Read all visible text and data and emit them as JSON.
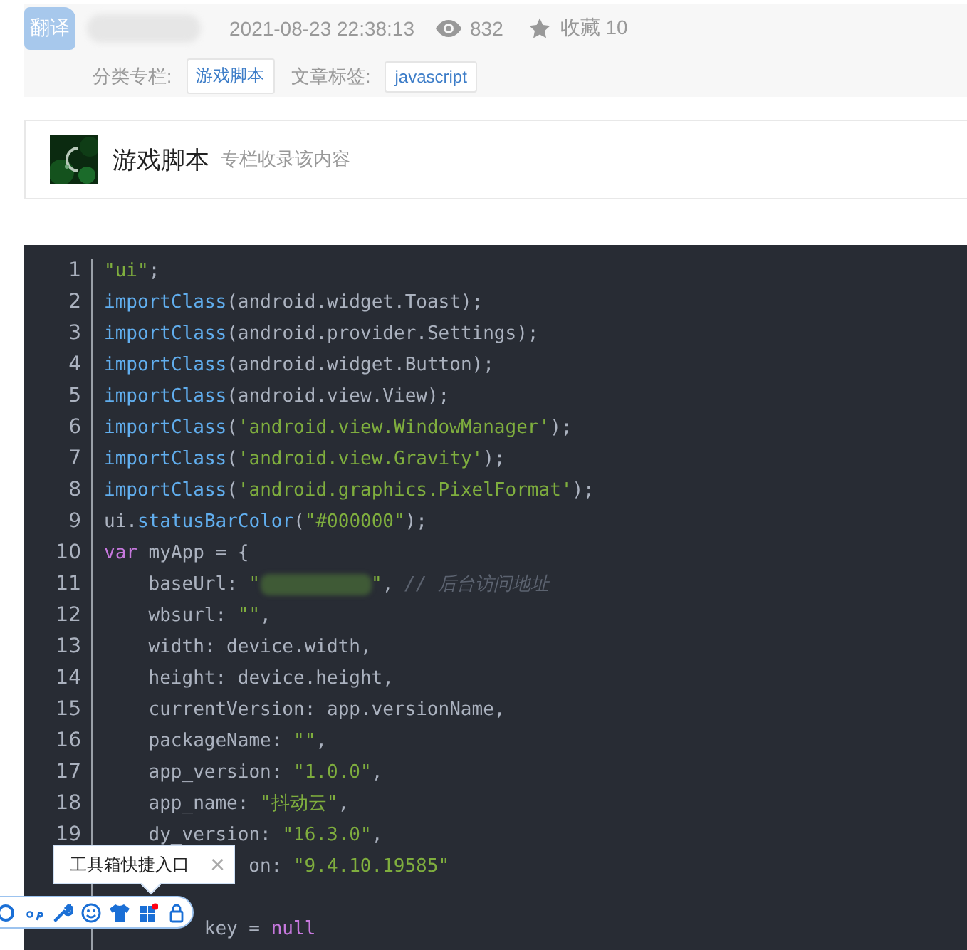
{
  "header": {
    "badge": "翻译",
    "date": "2021-08-23 22:38:13",
    "views": "832",
    "favorites": "收藏 10",
    "category_label": "分类专栏:",
    "category": "游戏脚本",
    "tags_label": "文章标签:",
    "tag": "javascript"
  },
  "column": {
    "title": "游戏脚本",
    "subtitle": "专栏收录该内容"
  },
  "code": [
    {
      "kind": "top",
      "number": "1",
      "segments": [
        {
          "kind": "str",
          "text": "\"ui\""
        },
        {
          "kind": "plain",
          "text": ";"
        }
      ]
    },
    {
      "kind": "top",
      "number": "2",
      "segments": [
        {
          "kind": "fn",
          "text": "importClass"
        },
        {
          "kind": "plain",
          "text": "(android.widget.Toast);"
        }
      ]
    },
    {
      "kind": "top",
      "number": "3",
      "segments": [
        {
          "kind": "fn",
          "text": "importClass"
        },
        {
          "kind": "plain",
          "text": "(android.provider.Settings);"
        }
      ]
    },
    {
      "kind": "top",
      "number": "4",
      "segments": [
        {
          "kind": "fn",
          "text": "importClass"
        },
        {
          "kind": "plain",
          "text": "(android.widget.Button);"
        }
      ]
    },
    {
      "kind": "top",
      "number": "5",
      "segments": [
        {
          "kind": "fn",
          "text": "importClass"
        },
        {
          "kind": "plain",
          "text": "(android.view.View);"
        }
      ]
    },
    {
      "kind": "top",
      "number": "6",
      "segments": [
        {
          "kind": "fn",
          "text": "importClass"
        },
        {
          "kind": "plain",
          "text": "("
        },
        {
          "kind": "str",
          "text": "'android.view.WindowManager'"
        },
        {
          "kind": "plain",
          "text": ");"
        }
      ]
    },
    {
      "kind": "top",
      "number": "7",
      "segments": [
        {
          "kind": "fn",
          "text": "importClass"
        },
        {
          "kind": "plain",
          "text": "("
        },
        {
          "kind": "str",
          "text": "'android.view.Gravity'"
        },
        {
          "kind": "plain",
          "text": ");"
        }
      ]
    },
    {
      "kind": "top",
      "number": "8",
      "segments": [
        {
          "kind": "fn",
          "text": "importClass"
        },
        {
          "kind": "plain",
          "text": "("
        },
        {
          "kind": "str",
          "text": "'android.graphics.PixelFormat'"
        },
        {
          "kind": "plain",
          "text": ");"
        }
      ]
    },
    {
      "kind": "top",
      "number": "9",
      "segments": [
        {
          "kind": "plain",
          "text": "ui."
        },
        {
          "kind": "fn",
          "text": "statusBarColor"
        },
        {
          "kind": "plain",
          "text": "("
        },
        {
          "kind": "str",
          "text": "\"#000000\""
        },
        {
          "kind": "plain",
          "text": ");"
        }
      ]
    },
    {
      "kind": "top",
      "number": "10",
      "segments": [
        {
          "kind": "kw",
          "text": "var"
        },
        {
          "kind": "plain",
          "text": " myApp = {"
        }
      ]
    },
    {
      "kind": "member",
      "number": "11",
      "segments": [
        {
          "kind": "plain",
          "text": "baseUrl: "
        },
        {
          "kind": "str",
          "text": "\""
        },
        {
          "kind": "blur"
        },
        {
          "kind": "str",
          "text": "\""
        },
        {
          "kind": "plain",
          "text": ", "
        },
        {
          "kind": "comment",
          "text": "// 后台访问地址"
        }
      ]
    },
    {
      "kind": "member",
      "number": "12",
      "segments": [
        {
          "kind": "plain",
          "text": "wbsurl: "
        },
        {
          "kind": "str",
          "text": "\"\""
        },
        {
          "kind": "plain",
          "text": ","
        }
      ]
    },
    {
      "kind": "member",
      "number": "13",
      "segments": [
        {
          "kind": "plain",
          "text": "width: device.width,"
        }
      ]
    },
    {
      "kind": "member",
      "number": "14",
      "segments": [
        {
          "kind": "plain",
          "text": "height: device.height,"
        }
      ]
    },
    {
      "kind": "member",
      "number": "15",
      "segments": [
        {
          "kind": "plain",
          "text": "currentVersion: app.versionName,"
        }
      ]
    },
    {
      "kind": "member",
      "number": "16",
      "segments": [
        {
          "kind": "plain",
          "text": "packageName: "
        },
        {
          "kind": "str",
          "text": "\"\""
        },
        {
          "kind": "plain",
          "text": ","
        }
      ]
    },
    {
      "kind": "member",
      "number": "17",
      "segments": [
        {
          "kind": "plain",
          "text": "app_version: "
        },
        {
          "kind": "str",
          "text": "\"1.0.0\""
        },
        {
          "kind": "plain",
          "text": ","
        }
      ]
    },
    {
      "kind": "member",
      "number": "18",
      "segments": [
        {
          "kind": "plain",
          "text": "app_name: "
        },
        {
          "kind": "str",
          "text": "\"抖动云\""
        },
        {
          "kind": "plain",
          "text": ","
        }
      ]
    },
    {
      "kind": "member",
      "number": "19",
      "segments": [
        {
          "kind": "plain",
          "text": "dy_version: "
        },
        {
          "kind": "str",
          "text": "\"16.3.0\""
        },
        {
          "kind": "plain",
          "text": ","
        }
      ]
    },
    {
      "kind": "covered_member",
      "segments": [
        {
          "kind": "plain",
          "text": "on: "
        },
        {
          "kind": "str",
          "text": "\"9.4.10.19585\""
        }
      ]
    },
    {
      "kind": "hidden"
    },
    {
      "kind": "covered_top",
      "segments": [
        {
          "kind": "plain",
          "text": "key = "
        },
        {
          "kind": "kw",
          "text": "null"
        }
      ]
    }
  ],
  "tooltip": {
    "text": "工具箱快捷入口",
    "close": "×"
  }
}
